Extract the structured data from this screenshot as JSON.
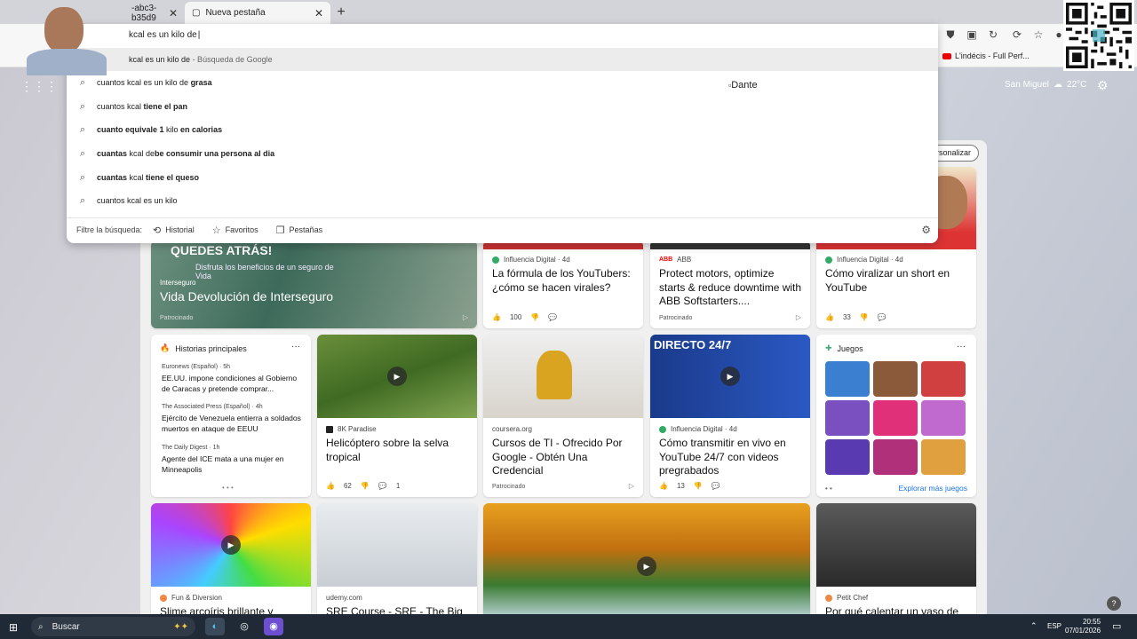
{
  "browser": {
    "tabs": [
      {
        "label": "-abc3-b35d9"
      },
      {
        "label": "Nueva pestaña"
      }
    ],
    "new_tab_icon": "plus-icon",
    "favorites": [
      {
        "label": "L'indécis - Full Perf..."
      }
    ]
  },
  "omnibox": {
    "input_value": "kcal es un kilo de",
    "first_suggestion": {
      "text": "kcal es un kilo de",
      "hint": "- Búsqueda de Google"
    },
    "image_alt": "Dante",
    "suggestions": [
      {
        "plain": "cuantos kcal es un kilo de ",
        "bold": "grasa"
      },
      {
        "plain": "cuantos kcal ",
        "bold": "tiene el pan"
      },
      {
        "pre": "cuanto equivale 1 ",
        "mid": "kilo",
        "bold": " en calorias"
      },
      {
        "pre": "cuantas ",
        "mid": "kcal de",
        "bold": "be consumir una persona al dia"
      },
      {
        "pre": "cuantas ",
        "mid": "kcal",
        "bold": " tiene el queso"
      },
      {
        "plain": "cuantos kcal es un kilo",
        "bold": ""
      }
    ],
    "filter": {
      "label": "Filtre la búsqueda:",
      "history": "Historial",
      "favorites": "Favoritos",
      "tabs": "Pestañas"
    }
  },
  "newtab": {
    "weather": {
      "city": "San Miguel",
      "temp": "22°C"
    },
    "personalize_label": "ersonalizar",
    "cards": {
      "ad_interseguro": {
        "banner": "QUEDES ATRÁS!",
        "banner_sub": "Disfruta los beneficios de un seguro de Vida",
        "brand": "Interseguro",
        "title": "Vida Devolución de Interseguro",
        "sponsored": "Patrocinado"
      },
      "youtubers": {
        "source": "Influencia Digital · 4d",
        "title": "La fórmula de los YouTubers: ¿cómo se hacen virales?",
        "likes": "100"
      },
      "abb": {
        "source": "ABB",
        "title": "Protect motors, optimize starts & reduce downtime with ABB Softstarters....",
        "sponsored": "Patrocinado"
      },
      "short": {
        "source": "Influencia Digital · 4d",
        "title": "Cómo viralizar un short en YouTube",
        "likes": "33"
      },
      "top_stories": {
        "header": "Historias principales",
        "items": [
          {
            "source": "Euronews (Español) · 5h",
            "title": "EE.UU. impone condiciones al Gobierno de Caracas y pretende comprar..."
          },
          {
            "source": "The Associated Press (Español) · 4h",
            "title": "Ejército de Venezuela entierra a soldados muertos en ataque de EEUU"
          },
          {
            "source": "The Daily Digest · 1h",
            "title": "Agente del ICE mata a una mujer en Minneapolis"
          }
        ]
      },
      "helicopter": {
        "source": "8K Paradise",
        "title": "Helicóptero sobre la selva tropical",
        "likes": "62",
        "comments": "1"
      },
      "coursera": {
        "source": "coursera.org",
        "title": "Cursos de TI - Ofrecido Por Google - Obtén Una Credencial",
        "sponsored": "Patrocinado"
      },
      "live": {
        "banner": "DIRECTO 24/7",
        "source": "Influencia Digital · 4d",
        "title": "Cómo transmitir en vivo en YouTube 24/7 con videos pregrabados",
        "likes": "13"
      },
      "games": {
        "header": "Juegos",
        "more": "Explorar más juegos"
      },
      "slime": {
        "source": "Fun & Diversion",
        "title": "Slime arcoíris brillante y"
      },
      "sre": {
        "source": "udemy.com",
        "title": "SRE Course - SRE - The Big"
      },
      "chef": {
        "source": "Petit Chef",
        "title": "Por qué calentar un vaso de"
      }
    }
  },
  "taskbar": {
    "search_placeholder": "Buscar",
    "lang": "ESP",
    "time": "20:55",
    "date": "07/01/2026"
  },
  "colors": {
    "accent": "#1a73e8",
    "taskbar": "#1f2a36"
  }
}
